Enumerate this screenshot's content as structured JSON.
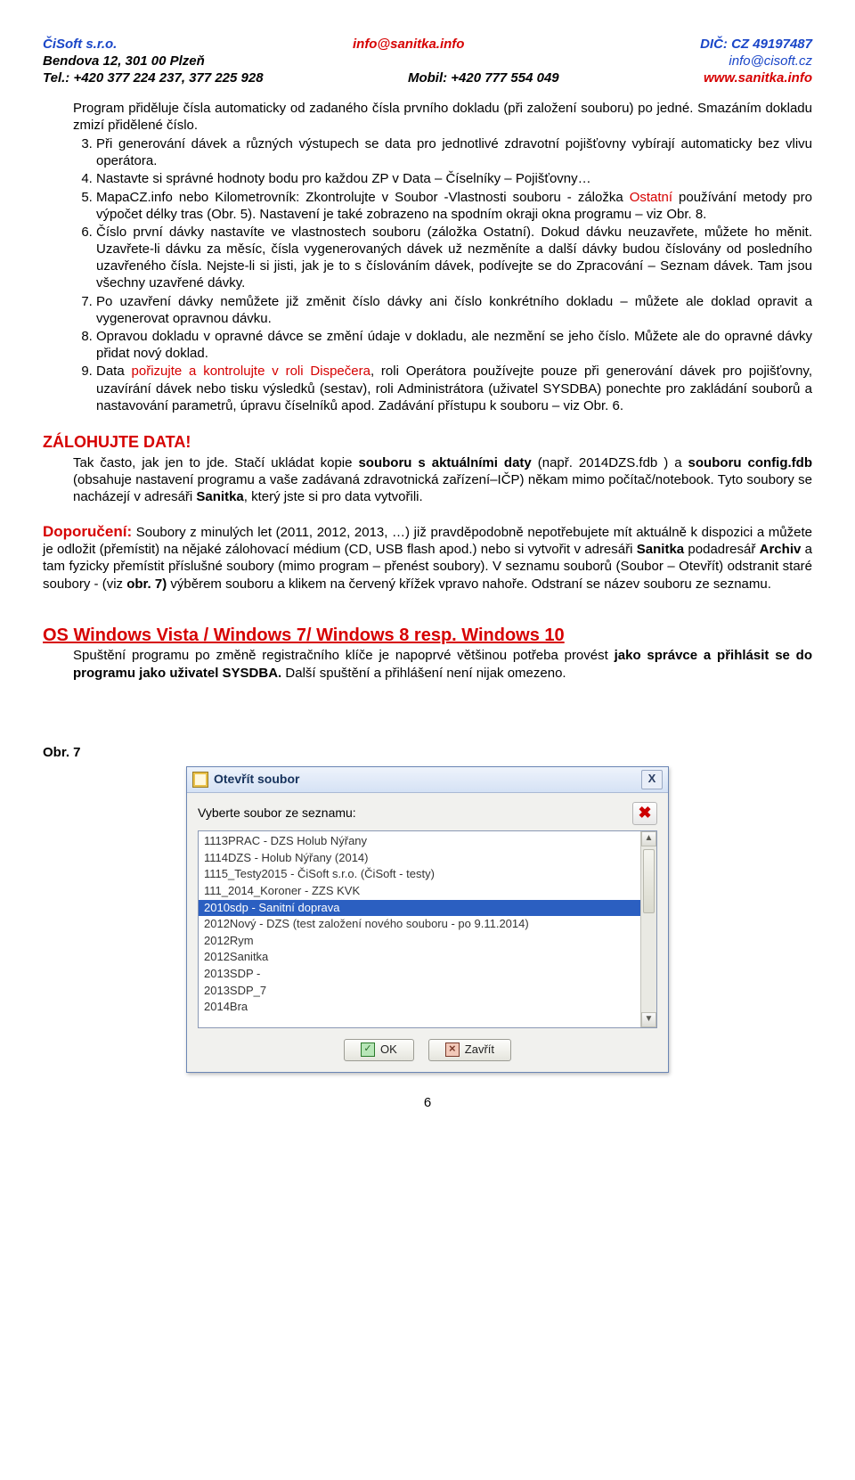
{
  "header": {
    "company": "ČiSoft s.r.o.",
    "email_info": "info@sanitka.info",
    "dic": "DIČ: CZ 49197487",
    "address": "Bendova 12, 301 00 Plzeň",
    "email_cisoft": "info@cisoft.cz",
    "tel": "Tel.: +420 377 224 237, 377 225 928",
    "mobil": "Mobil: +420 777 554 049",
    "url": "www.sanitka.info"
  },
  "intro_para": "Program přiděluje čísla automaticky od zadaného čísla prvního dokladu (při založení souboru) po jedné. Smazáním dokladu zmizí přidělené číslo.",
  "items": {
    "i3": "Při generování dávek a různých výstupech se data pro jednotlivé zdravotní pojišťovny vybírají automaticky bez vlivu operátora.",
    "i4": "Nastavte si správné hodnoty bodu pro každou ZP v Data – Číselníky – Pojišťovny…",
    "i5a": "MapaCZ.info nebo Kilometrovník: Zkontrolujte v Soubor -Vlastnosti souboru - záložka ",
    "i5b_ost": "Ostatní",
    "i5c": " používání metody pro výpočet délky tras (Obr. 5). Nastavení je také zobrazeno na spodním okraji okna programu – viz Obr. 8.",
    "i6": "Číslo první dávky nastavíte ve vlastnostech souboru (záložka Ostatní). Dokud dávku neuzavřete, můžete ho měnit. Uzavřete-li dávku za měsíc, čísla vygenerovaných dávek už nezměníte a další dávky budou číslovány od posledního uzavřeného čísla. Nejste-li si jisti, jak je to s číslováním dávek, podívejte se do Zpracování – Seznam dávek. Tam jsou všechny uzavřené dávky.",
    "i7": "Po uzavření dávky nemůžete již změnit číslo dávky ani číslo konkrétního dokladu – můžete ale doklad opravit a vygenerovat opravnou dávku.",
    "i8": "Opravou dokladu v opravné dávce se změní údaje v dokladu, ale nezmění se jeho číslo. Můžete ale do opravné dávky přidat nový doklad.",
    "i9a": "Data ",
    "i9b_red": "pořizujte a kontrolujte v roli Dispečera",
    "i9c": ", roli Operátora používejte pouze při generování dávek pro pojišťovny, uzavírání dávek nebo tisku výsledků (sestav), roli Administrátora (uživatel SYSDBA) ponechte pro zakládání souborů a nastavování parametrů, úpravu číselníků apod. Zadávání přístupu k souboru – viz Obr. 6."
  },
  "zalohujte": {
    "head": "ZÁLOHUJTE DATA!",
    "p1a": "Tak často, jak jen to jde. Stačí ukládat kopie ",
    "p1b_bold": "souboru s aktuálními daty",
    "p1c": " (např. 2014DZS.fdb ) a ",
    "p1d_bold": "souboru config.fdb",
    "p1e": " (obsahuje nastavení programu a vaše zadávaná zdravotnická zařízení–IČP) někam mimo počítač/notebook. Tyto soubory se nacházejí v adresáři ",
    "p1f_bold": "Sanitka",
    "p1g": ", který jste si pro data vytvořili."
  },
  "doporuceni": {
    "label": "Doporučení:",
    "p_a": " Soubory z minulých let (2011, 2012, 2013, …) již pravděpodobně nepotřebujete mít aktuálně k dispozici a můžete je odložit (přemístit) na nějaké zálohovací médium (CD, USB flash apod.) nebo si vytvořit v adresáři ",
    "p_b_bold": "Sanitka",
    "p_c": " podadresář ",
    "p_d_bold": "Archiv",
    "p_e": " a tam fyzicky přemístit příslušné soubory (mimo program – přenést soubory). V seznamu souborů (Soubor – Otevřít) odstranit staré soubory - (viz ",
    "p_f_bold": "obr. 7)",
    "p_g": " výběrem souboru a klikem na červený křížek vpravo nahoře. Odstraní se název souboru ze seznamu."
  },
  "os": {
    "head": "OS  Windows Vista / Windows 7/ Windows 8 resp. Windows 10",
    "p_a": "Spuštění programu po změně registračního klíče je napoprvé většinou potřeba provést ",
    "p_b_bold": "jako správce a přihlásit se do programu jako uživatel SYSDBA.",
    "p_c": " Další spuštění a přihlášení není nijak omezeno."
  },
  "obr7_label": "Obr. 7",
  "dialog": {
    "title": "Otevřít soubor",
    "prompt": "Vyberte soubor ze seznamu:",
    "items": [
      "1113PRAC - DZS Holub Nýřany",
      "1114DZS - Holub Nýřany (2014)",
      "1115_Testy2015 - ČiSoft s.r.o. (ČiSoft - testy)",
      "111_2014_Koroner - ZZS KVK",
      "2010sdp - Sanitní doprava",
      "2012Nový - DZS (test založení nového souboru - po 9.11.2014)",
      "2012Rym",
      "2012Sanitka",
      "2013SDP -",
      "2013SDP_7",
      "2014Bra"
    ],
    "selected_index": 4,
    "ok": "OK",
    "close": "Zavřít"
  },
  "page_number": "6"
}
